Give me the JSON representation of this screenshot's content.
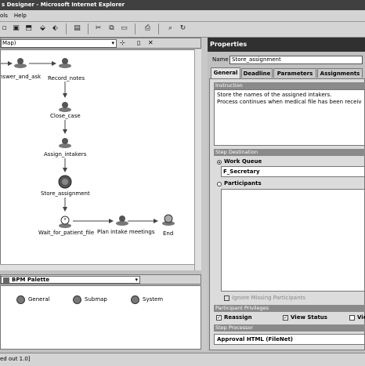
{
  "window": {
    "title": "s Designer - Microsoft Internet Explorer"
  },
  "menu": [
    "ols",
    "Help"
  ],
  "map": {
    "selector": "Map)",
    "nodes": [
      {
        "label": "nswer_and_ask"
      },
      {
        "label": "Record_notes"
      },
      {
        "label": "Close_case"
      },
      {
        "label": "Assign_intakers"
      },
      {
        "label": "Store_assignment"
      },
      {
        "label": "Wait_for_patient_file"
      },
      {
        "label": "Plan intake meetings"
      },
      {
        "label": "End"
      }
    ]
  },
  "palette": {
    "selector": "BPM Palette",
    "items": [
      {
        "label": "General"
      },
      {
        "label": "Submap"
      },
      {
        "label": "System"
      }
    ]
  },
  "status": {
    "text": "ed out 1.0]"
  },
  "properties": {
    "header": "Properties",
    "name_label": "Name",
    "name_value": "Store_assignment",
    "tabs": [
      "General",
      "Deadline",
      "Parameters",
      "Assignments"
    ],
    "instruction_header": "Instruction",
    "instruction_text": "Store the names of the assigned intakers.\nProcess continues when medical file has been received p",
    "destination_header": "Step Destination",
    "work_queue_label": "Work Queue",
    "work_queue_value": "F_Secretary",
    "participants_label": "Participants",
    "ignore_missing_label": "Ignore Missing Participants",
    "privileges_header": "Participant Privileges",
    "reassign_label": "Reassign",
    "view_status_label": "View Status",
    "view_cut_label": "Vie",
    "processor_header": "Step Processor",
    "approval_value": "Approval HTML (FileNet)"
  }
}
